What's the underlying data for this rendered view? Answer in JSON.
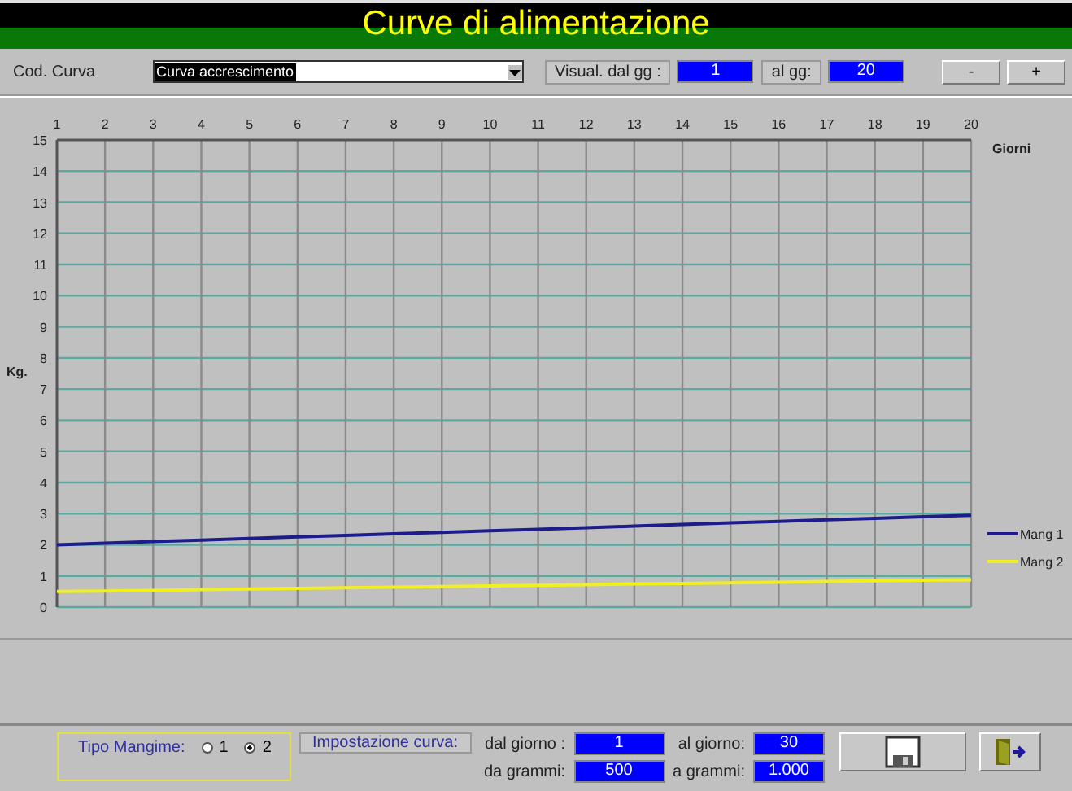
{
  "window": {
    "title": "Curve di alimentazione"
  },
  "toolbar": {
    "curve_label": "Cod. Curva",
    "curve_value": "Curva accrescimento",
    "from_label": "Visual. dal gg :",
    "from_day": "1",
    "to_label": "al gg:",
    "to_day": "20",
    "buttons": [
      "-",
      "+"
    ]
  },
  "chart": {
    "chart_data": {
      "type": "line",
      "grid": true,
      "legend": "right",
      "xlabel": "Giorni",
      "ylabel": "Kg.",
      "x": [
        1,
        2,
        3,
        4,
        5,
        6,
        7,
        8,
        9,
        10,
        11,
        12,
        13,
        14,
        15,
        16,
        17,
        18,
        19,
        20
      ],
      "xlim": [
        1,
        20
      ],
      "ylim": [
        0,
        15
      ],
      "xticks": [
        1,
        2,
        3,
        4,
        5,
        6,
        7,
        8,
        9,
        10,
        11,
        12,
        13,
        14,
        15,
        16,
        17,
        18,
        19,
        20
      ],
      "yticks": [
        0,
        1,
        2,
        3,
        4,
        5,
        6,
        7,
        8,
        9,
        10,
        11,
        12,
        13,
        14,
        15
      ],
      "series": [
        {
          "name": "Mang 1",
          "color": "#1c1c8c",
          "values": [
            2.0,
            2.05,
            2.1,
            2.15,
            2.2,
            2.25,
            2.3,
            2.35,
            2.4,
            2.45,
            2.5,
            2.55,
            2.6,
            2.65,
            2.7,
            2.75,
            2.8,
            2.85,
            2.9,
            2.95
          ]
        },
        {
          "name": "Mang 2",
          "color": "#f0f020",
          "values": [
            0.5,
            0.52,
            0.54,
            0.56,
            0.58,
            0.6,
            0.62,
            0.64,
            0.66,
            0.68,
            0.7,
            0.72,
            0.74,
            0.76,
            0.78,
            0.8,
            0.82,
            0.84,
            0.86,
            0.88
          ]
        }
      ]
    }
  },
  "bottom": {
    "feed_label": "Tipo Mangime:",
    "feed_options": [
      {
        "label": "1",
        "selected": false
      },
      {
        "label": "2",
        "selected": true
      }
    ],
    "setting_label": "Impostazione curva:",
    "fields": [
      {
        "label": "dal giorno :",
        "value": "1"
      },
      {
        "label": "al giorno:",
        "value": "30"
      },
      {
        "label": "da grammi:",
        "value": "500"
      },
      {
        "label": "a grammi:",
        "value": "1.000"
      }
    ]
  }
}
